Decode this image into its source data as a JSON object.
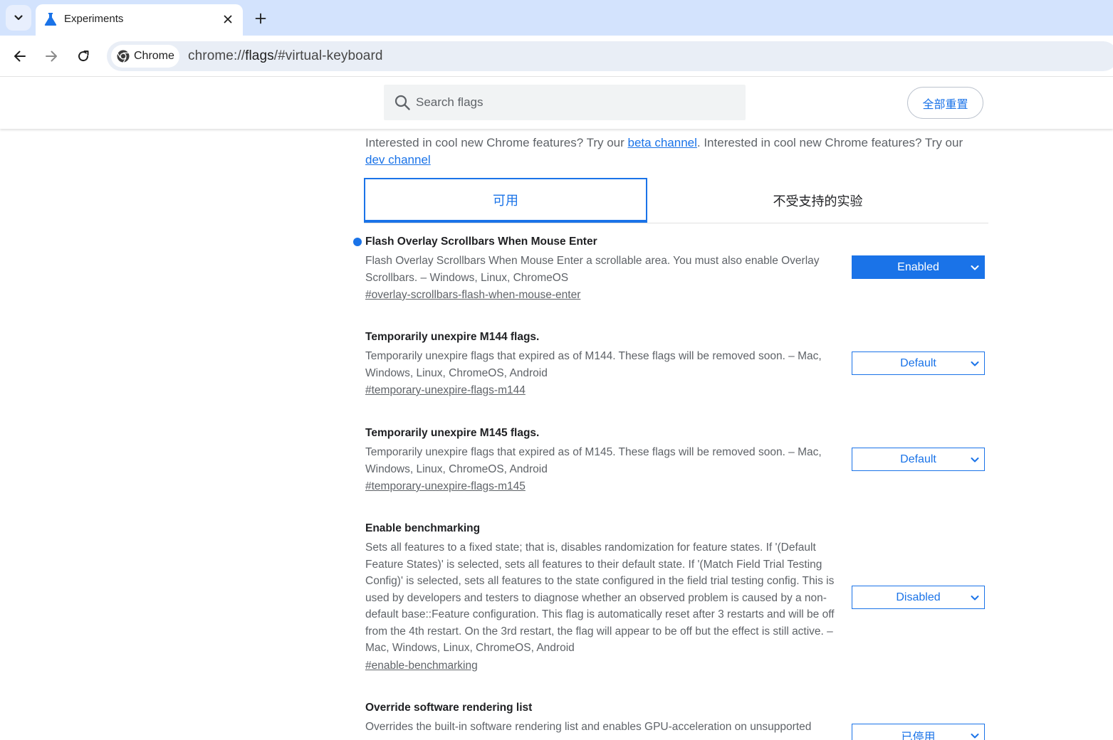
{
  "browser": {
    "tab": {
      "title": "Experiments"
    },
    "omnibox": {
      "chip_label": "Chrome",
      "url_scheme": "chrome://",
      "url_host": "flags",
      "url_path": "/#virtual-keyboard"
    }
  },
  "header": {
    "search_placeholder": "Search flags",
    "reset_label": "全部重置"
  },
  "promo": {
    "text_1": "Interested in cool new Chrome features? Try our ",
    "link_1": "beta channel",
    "text_2": ". Interested in cool new Chrome features? Try our ",
    "link_2": "dev channel"
  },
  "tabs": {
    "available": "可用",
    "unavailable": "不受支持的实验"
  },
  "experiments": [
    {
      "title": "Flash Overlay Scrollbars When Mouse Enter",
      "description": "Flash Overlay Scrollbars When Mouse Enter a scrollable area. You must also enable Overlay Scrollbars. – Windows, Linux, ChromeOS",
      "link": "#overlay-scrollbars-flash-when-mouse-enter",
      "value": "Enabled"
    },
    {
      "title": "Temporarily unexpire M144 flags.",
      "description": "Temporarily unexpire flags that expired as of M144. These flags will be removed soon. – Mac, Windows, Linux, ChromeOS, Android",
      "link": "#temporary-unexpire-flags-m144",
      "value": "Default"
    },
    {
      "title": "Temporarily unexpire M145 flags.",
      "description": "Temporarily unexpire flags that expired as of M145. These flags will be removed soon. – Mac, Windows, Linux, ChromeOS, Android",
      "link": "#temporary-unexpire-flags-m145",
      "value": "Default"
    },
    {
      "title": "Enable benchmarking",
      "description": "Sets all features to a fixed state; that is, disables randomization for feature states. If '(Default Feature States)' is selected, sets all features to their default state. If '(Match Field Trial Testing Config)' is selected, sets all features to the state configured in the field trial testing config. This is used by developers and testers to diagnose whether an observed problem is caused by a non-default base::Feature configuration. This flag is automatically reset after 3 restarts and will be off from the 4th restart. On the 3rd restart, the flag will appear to be off but the effect is still active. – Mac, Windows, Linux, ChromeOS, Android",
      "link": "#enable-benchmarking",
      "value": "Disabled"
    },
    {
      "title": "Override software rendering list",
      "description": "Overrides the built-in software rendering list and enables GPU-acceleration on unsupported",
      "value": "已停用"
    }
  ],
  "colors": {
    "accent": "#1a73e8",
    "tabstrip": "#d3e3fd",
    "omnibox": "#e9eef6"
  }
}
